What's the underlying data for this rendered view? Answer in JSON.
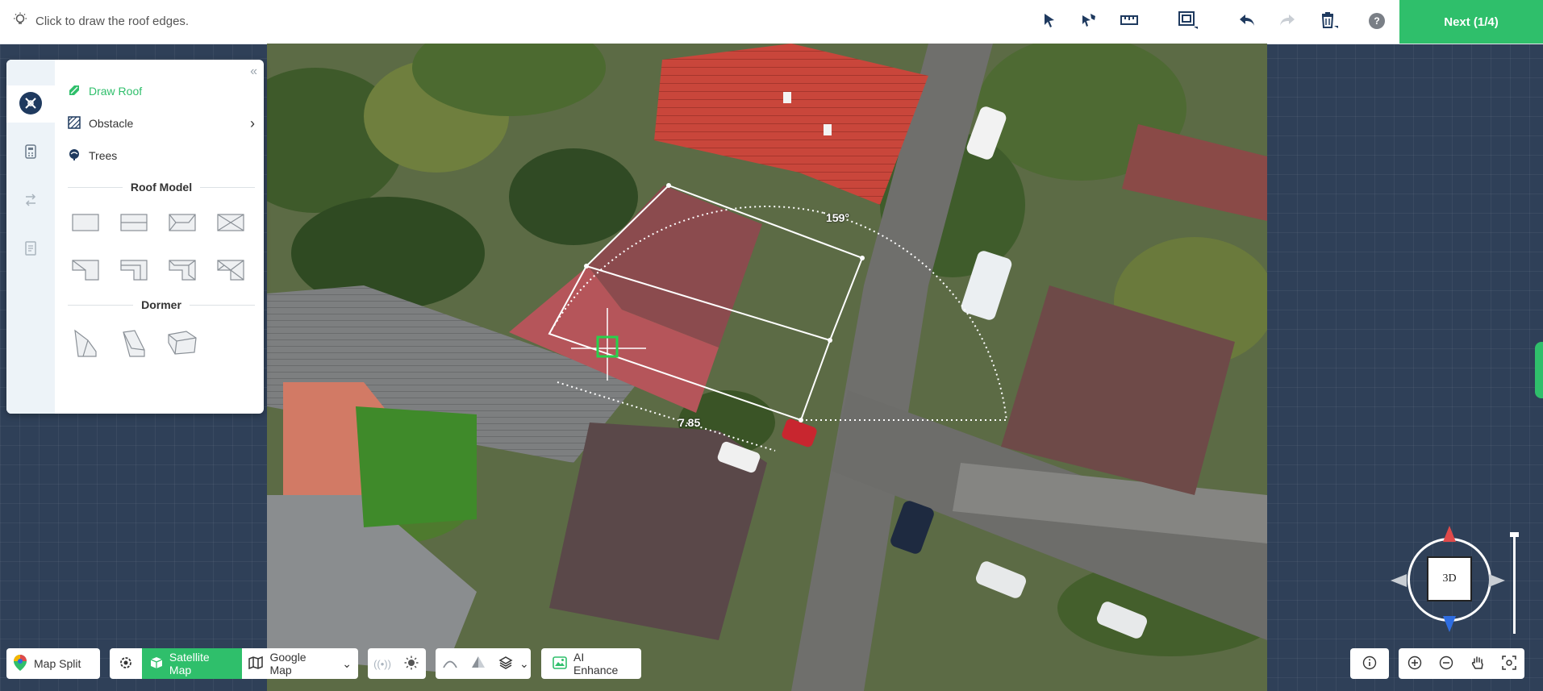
{
  "topbar": {
    "hint": "Click to draw the roof edges.",
    "next_label": "Next (1/4)",
    "help_label": "?"
  },
  "panel": {
    "menu": {
      "draw_roof": "Draw Roof",
      "obstacle": "Obstacle",
      "trees": "Trees"
    },
    "roof_model_title": "Roof Model",
    "dormer_title": "Dormer"
  },
  "map": {
    "angle_label": "159°",
    "distance_label": "7.85"
  },
  "compass": {
    "label": "3D"
  },
  "bottom": {
    "map_split": "Map Split",
    "satellite_map": "Satellite Map",
    "google_map": "Google Map",
    "ai_enhance": "AI Enhance"
  },
  "colors": {
    "accent": "#2fbf6b",
    "background": "#2f4058",
    "roof_red": "#b53f3a"
  }
}
